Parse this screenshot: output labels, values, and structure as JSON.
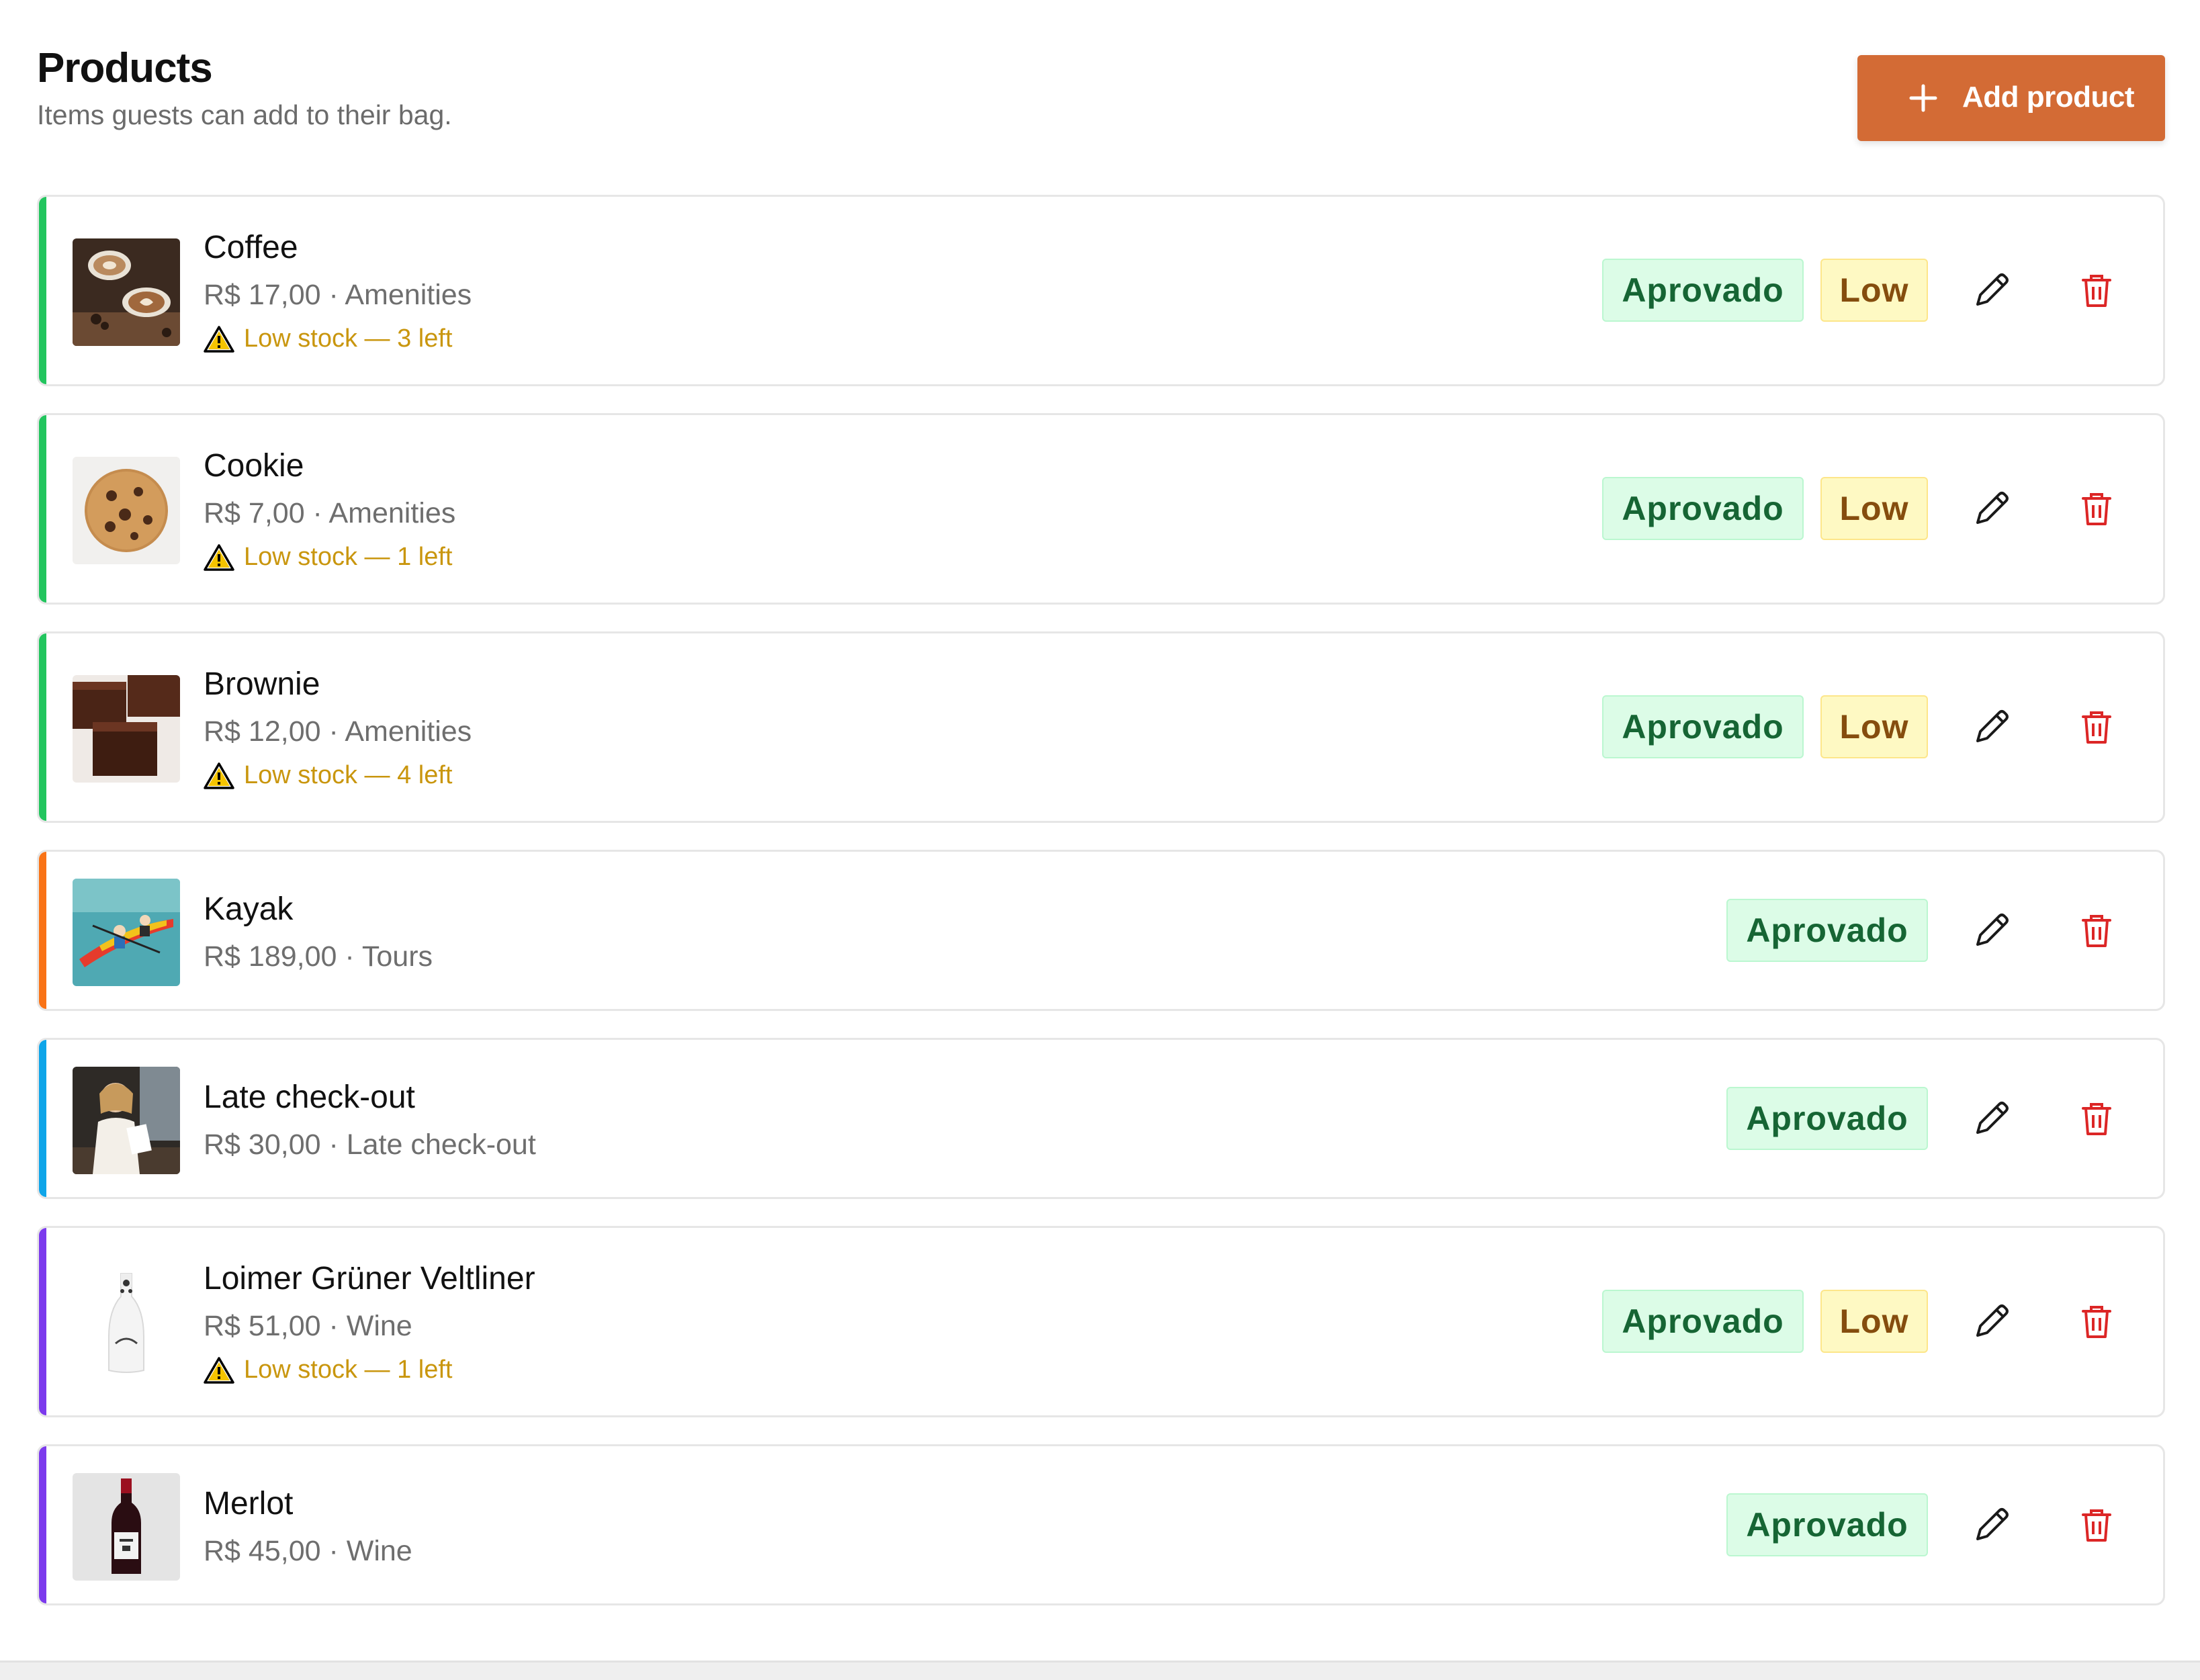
{
  "header": {
    "title": "Products",
    "subtitle": "Items guests can add to their bag.",
    "add_button_label": "Add product"
  },
  "colors": {
    "add_button": "#d36b35",
    "approved_bg": "#dcfce7",
    "approved_text": "#166534",
    "low_bg": "#fef9c3",
    "low_text": "#854d0e",
    "warning_text": "#c9960e",
    "delete_icon": "#dc2626",
    "accent_amenities": "#22c55e",
    "accent_tours": "#f97316",
    "accent_late_checkout": "#0ea5e9",
    "accent_wine": "#7c3aed"
  },
  "products": [
    {
      "name": "Coffee",
      "meta": "R$ 17,00 · Amenities",
      "warning": "Low stock — 3 left",
      "status": "Aprovado",
      "stock_badge": "Low",
      "image": "coffee-image"
    },
    {
      "name": "Cookie",
      "meta": "R$ 7,00 · Amenities",
      "warning": "Low stock — 1 left",
      "status": "Aprovado",
      "stock_badge": "Low",
      "image": "cookie-image"
    },
    {
      "name": "Brownie",
      "meta": "R$ 12,00 · Amenities",
      "warning": "Low stock — 4 left",
      "status": "Aprovado",
      "stock_badge": "Low",
      "image": "brownie-image"
    },
    {
      "name": "Kayak",
      "meta": "R$ 189,00 · Tours",
      "status": "Aprovado",
      "image": "kayak-image"
    },
    {
      "name": "Late check-out",
      "meta": "R$ 30,00 · Late check-out",
      "status": "Aprovado",
      "image": "late-checkout-image"
    },
    {
      "name": "Loimer Grüner Veltliner",
      "meta": "R$ 51,00 · Wine",
      "warning": "Low stock — 1 left",
      "status": "Aprovado",
      "stock_badge": "Low",
      "image": "white-wine-bottle-image"
    },
    {
      "name": "Merlot",
      "meta": "R$ 45,00 · Wine",
      "status": "Aprovado",
      "image": "red-wine-bottle-image"
    }
  ],
  "icons": {
    "add": "plus-icon",
    "edit": "pencil-icon",
    "delete": "trash-icon",
    "warning": "warning-triangle-icon"
  }
}
